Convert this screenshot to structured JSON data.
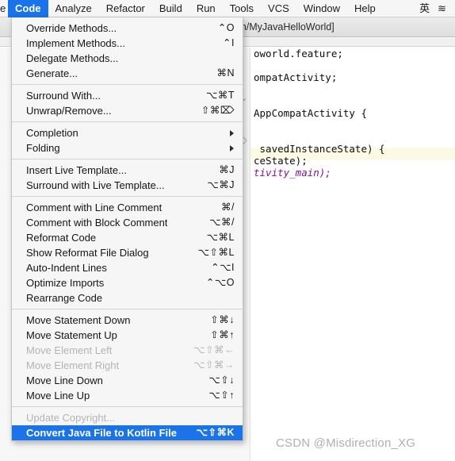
{
  "menubar": {
    "partial_left": "e",
    "items": [
      {
        "label": "Code",
        "active": true
      },
      {
        "label": "Analyze",
        "active": false
      },
      {
        "label": "Refactor",
        "active": false
      },
      {
        "label": "Build",
        "active": false
      },
      {
        "label": "Run",
        "active": false
      },
      {
        "label": "Tools",
        "active": false
      },
      {
        "label": "VCS",
        "active": false
      },
      {
        "label": "Window",
        "active": false
      },
      {
        "label": "Help",
        "active": false
      }
    ],
    "status_icons": [
      {
        "name": "input-source-icon",
        "glyph": "英"
      },
      {
        "name": "wifi-icon",
        "glyph": "≋"
      }
    ]
  },
  "window": {
    "title": "MyJavaHelloWorld - [~/kotlin/MyJavaHelloWorld]"
  },
  "editor": {
    "gutter_marks": [
      "⌄",
      "◇"
    ],
    "lines": [
      {
        "text": "oworld.feature;",
        "style": "plain"
      },
      {
        "text": "",
        "style": "plain"
      },
      {
        "text": "ompatActivity;",
        "style": "plain"
      },
      {
        "text": "",
        "style": "plain"
      },
      {
        "text": "",
        "style": "plain"
      },
      {
        "text": "AppCompatActivity {",
        "style": "plain"
      },
      {
        "text": "",
        "style": "plain"
      },
      {
        "text": "",
        "style": "plain"
      },
      {
        "text": " savedInstanceState) {",
        "style": "plain"
      },
      {
        "text": "ceState);",
        "style": "plain"
      },
      {
        "text": "tivity_main);",
        "style": "field"
      }
    ]
  },
  "menu": {
    "name": "code-menu",
    "groups": [
      {
        "items": [
          {
            "label": "Override Methods...",
            "shortcut": "⌃O",
            "state": "normal"
          },
          {
            "label": "Implement Methods...",
            "shortcut": "⌃I",
            "state": "normal"
          },
          {
            "label": "Delegate Methods...",
            "shortcut": "",
            "state": "normal"
          },
          {
            "label": "Generate...",
            "shortcut": "⌘N",
            "state": "normal"
          }
        ]
      },
      {
        "items": [
          {
            "label": "Surround With...",
            "shortcut": "⌥⌘T",
            "state": "normal"
          },
          {
            "label": "Unwrap/Remove...",
            "shortcut": "⇧⌘⌦",
            "state": "normal"
          }
        ]
      },
      {
        "items": [
          {
            "label": "Completion",
            "shortcut": "",
            "state": "normal",
            "submenu": true
          },
          {
            "label": "Folding",
            "shortcut": "",
            "state": "normal",
            "submenu": true
          }
        ]
      },
      {
        "items": [
          {
            "label": "Insert Live Template...",
            "shortcut": "⌘J",
            "state": "normal"
          },
          {
            "label": "Surround with Live Template...",
            "shortcut": "⌥⌘J",
            "state": "normal"
          }
        ]
      },
      {
        "items": [
          {
            "label": "Comment with Line Comment",
            "shortcut": "⌘/",
            "state": "normal"
          },
          {
            "label": "Comment with Block Comment",
            "shortcut": "⌥⌘/",
            "state": "normal"
          },
          {
            "label": "Reformat Code",
            "shortcut": "⌥⌘L",
            "state": "normal"
          },
          {
            "label": "Show Reformat File Dialog",
            "shortcut": "⌥⇧⌘L",
            "state": "normal"
          },
          {
            "label": "Auto-Indent Lines",
            "shortcut": "⌃⌥I",
            "state": "normal"
          },
          {
            "label": "Optimize Imports",
            "shortcut": "⌃⌥O",
            "state": "normal"
          },
          {
            "label": "Rearrange Code",
            "shortcut": "",
            "state": "normal"
          }
        ]
      },
      {
        "items": [
          {
            "label": "Move Statement Down",
            "shortcut": "⇧⌘↓",
            "state": "normal"
          },
          {
            "label": "Move Statement Up",
            "shortcut": "⇧⌘↑",
            "state": "normal"
          },
          {
            "label": "Move Element Left",
            "shortcut": "⌥⇧⌘←",
            "state": "disabled"
          },
          {
            "label": "Move Element Right",
            "shortcut": "⌥⇧⌘→",
            "state": "disabled"
          },
          {
            "label": "Move Line Down",
            "shortcut": "⌥⇧↓",
            "state": "normal"
          },
          {
            "label": "Move Line Up",
            "shortcut": "⌥⇧↑",
            "state": "normal"
          }
        ]
      },
      {
        "items": [
          {
            "label": "Update Copyright...",
            "shortcut": "",
            "state": "disabled"
          },
          {
            "label": "Convert Java File to Kotlin File",
            "shortcut": "⌥⇧⌘K",
            "state": "selected"
          }
        ]
      }
    ]
  },
  "watermark": {
    "text": "CSDN @Misdirection_XG"
  },
  "colors": {
    "accent": "#1a73e8",
    "menu_bg": "#f6f6f6",
    "disabled_text": "#b4b4b4",
    "caret_line": "#fcf9e4"
  }
}
